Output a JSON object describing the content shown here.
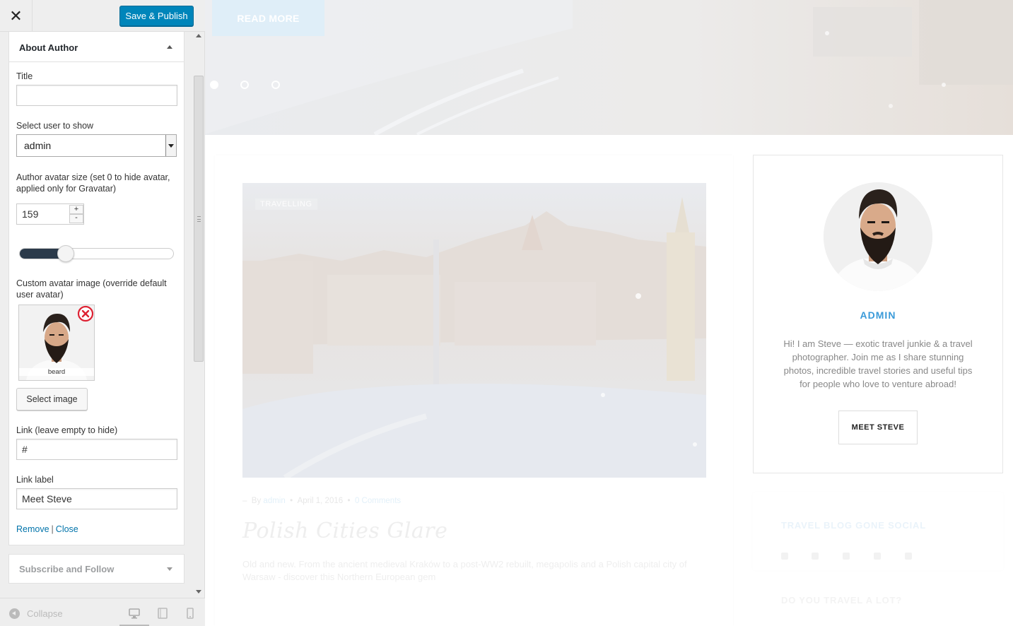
{
  "toolbar": {
    "close_icon": "close-icon",
    "publish_label": "Save & Publish"
  },
  "widget": {
    "title": "About Author",
    "fields": {
      "title_label": "Title",
      "title_value": "",
      "user_label": "Select user to show",
      "user_value": "admin",
      "avatar_size_label": "Author avatar size (set 0 to hide avatar, applied only for Gravatar)",
      "avatar_size_value": "159",
      "avatar_size_fraction": 0.3,
      "stepper_up": "+",
      "stepper_down": "-",
      "custom_avatar_label": "Custom avatar image (override default user avatar)",
      "custom_avatar_filename": "beard",
      "select_image_label": "Select image",
      "link_label": "Link (leave empty to hide)",
      "link_value": "#",
      "link_text_label": "Link label",
      "link_text_value": "Meet Steve"
    },
    "actions": {
      "remove": "Remove",
      "separator": "|",
      "close": "Close"
    }
  },
  "next_widget": {
    "title": "Subscribe and Follow"
  },
  "footer": {
    "collapse_label": "Collapse",
    "devices": [
      "desktop-icon",
      "tablet-icon",
      "mobile-icon"
    ]
  },
  "preview": {
    "hero": {
      "read_more": "READ MORE",
      "slide_count": 3,
      "active_slide": 1
    },
    "post": {
      "category": "TRAVELLING",
      "meta_prefix": "By",
      "author": "admin",
      "date": "April 1, 2016",
      "comments": "0 Comments",
      "title": "Polish Cities Glare",
      "excerpt": "Old and new. From the ancient medieval Kraków to a post-WW2 rebuilt, megapolis and a Polish capital city of Warsaw - discover this Northern European gem"
    },
    "author_box": {
      "name": "ADMIN",
      "bio": "Hi! I am Steve — exotic travel junkie & a travel photographer. Join me as I share stunning photos, incredible travel stories and useful tips for people who love to venture abroad!",
      "button": "MEET STEVE"
    },
    "social_title": "TRAVEL BLOG GONE SOCIAL",
    "social_icons": [
      "facebook-icon",
      "twitter-icon",
      "google-plus-icon",
      "vk-icon",
      "instagram-icon"
    ],
    "next_widget_title": "DO YOU TRAVEL A LOT?"
  },
  "colors": {
    "accent": "#0085ba",
    "link": "#0073aa",
    "author_name": "#3a9ad9",
    "slider_fill": "#2b3a4a"
  }
}
